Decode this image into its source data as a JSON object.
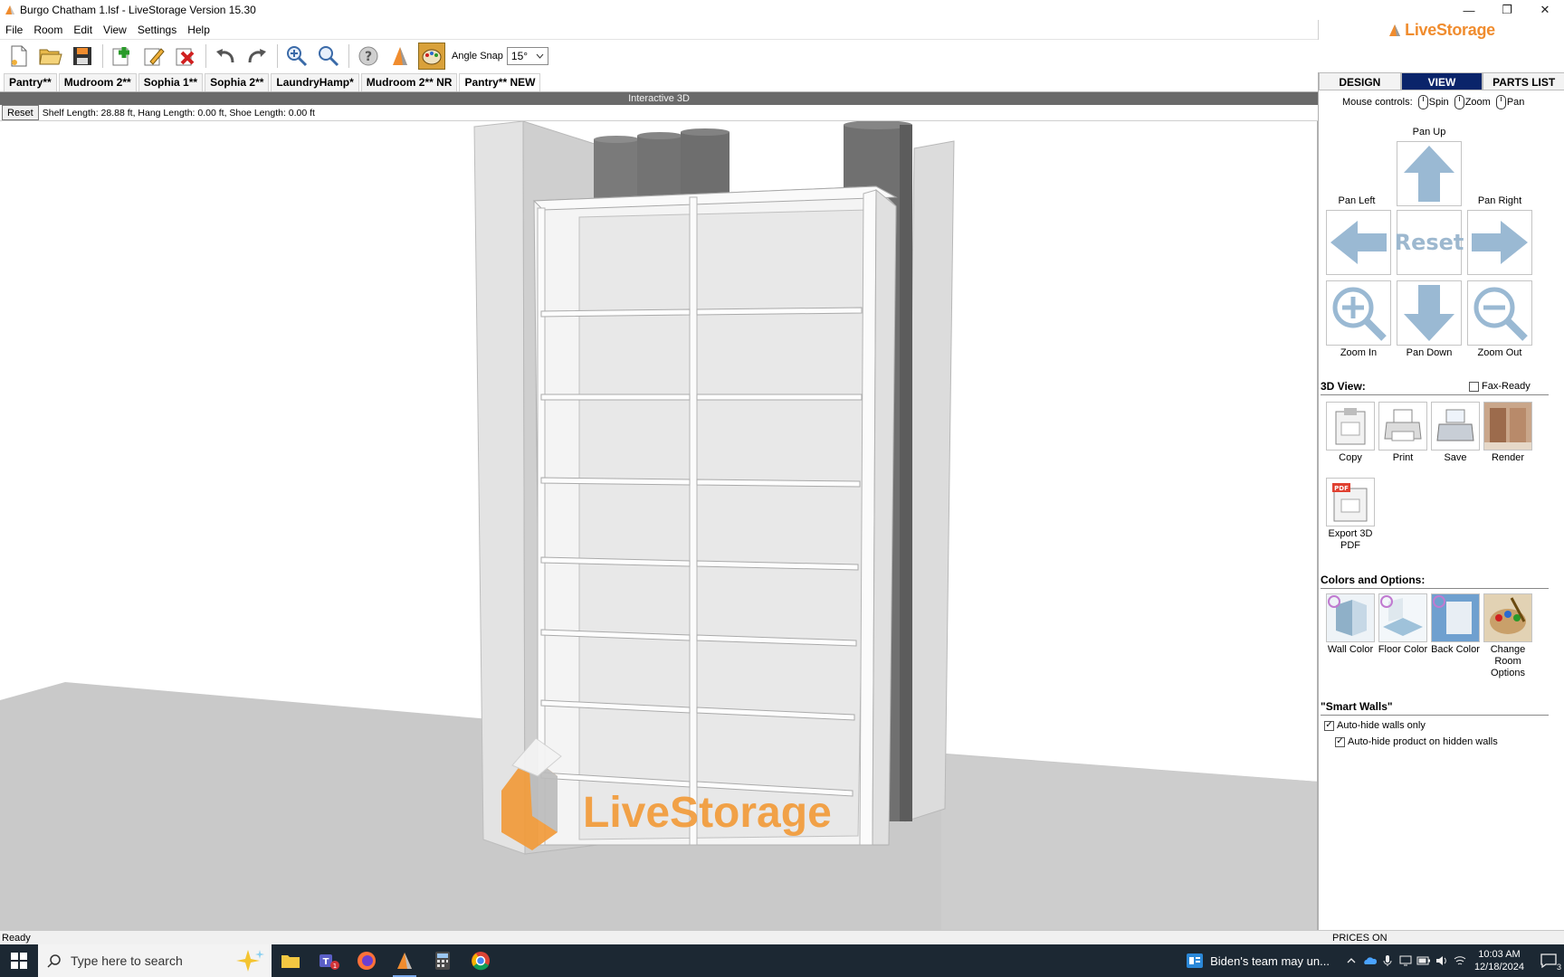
{
  "window": {
    "title": "Burgo Chatham 1.lsf - LiveStorage Version 15.30",
    "controls": [
      "—",
      "❐",
      "✕"
    ]
  },
  "menu": [
    "File",
    "Room",
    "Edit",
    "View",
    "Settings",
    "Help"
  ],
  "brand": {
    "name": "LiveStorage",
    "color": "#f08c2e"
  },
  "toolbar": {
    "angle_snap_label": "Angle Snap",
    "angle_snap_value": "15°"
  },
  "room_tabs": [
    {
      "label": "Pantry**"
    },
    {
      "label": "Mudroom 2**"
    },
    {
      "label": "Sophia 1**"
    },
    {
      "label": "Sophia 2**"
    },
    {
      "label": "LaundryHamp*"
    },
    {
      "label": "Mudroom 2** NR"
    },
    {
      "label": "Pantry** NEW",
      "active": true
    }
  ],
  "viewport": {
    "header": "Interactive 3D",
    "reset_label": "Reset",
    "info": "Shelf Length: 28.88 ft, Hang Length: 0.00 ft, Shoe Length: 0.00 ft",
    "watermark": "LiveStorage"
  },
  "panel": {
    "tabs": [
      {
        "label": "DESIGN"
      },
      {
        "label": "VIEW",
        "active": true
      },
      {
        "label": "PARTS LIST"
      }
    ],
    "mouse_controls": {
      "label": "Mouse controls:",
      "spin": "Spin",
      "zoom": "Zoom",
      "pan": "Pan"
    },
    "nav": {
      "pan_up": "Pan Up",
      "pan_left": "Pan Left",
      "pan_right": "Pan Right",
      "reset": "Reset",
      "zoom_in": "Zoom In",
      "pan_down": "Pan Down",
      "zoom_out": "Zoom Out"
    },
    "view3d": {
      "title": "3D View:",
      "fax_ready": "Fax-Ready",
      "copy": "Copy",
      "print": "Print",
      "save": "Save",
      "render": "Render",
      "export_pdf": "Export 3D PDF",
      "pdf_badge": "PDF"
    },
    "colors": {
      "title": "Colors and Options:",
      "wall": "Wall Color",
      "floor": "Floor Color",
      "back": "Back Color",
      "room": "Change Room Options"
    },
    "smart_walls": {
      "title": "\"Smart Walls\"",
      "auto_hide_walls": "Auto-hide walls only",
      "auto_hide_walls_checked": true,
      "auto_hide_product": "Auto-hide product on hidden walls",
      "auto_hide_product_checked": true
    }
  },
  "status": {
    "left": "Ready",
    "right": "PRICES ON"
  },
  "taskbar": {
    "search_placeholder": "Type here to search",
    "news": "Biden's team may un...",
    "time": "10:03 AM",
    "date": "12/18/2024",
    "notification_count": "3",
    "teams_badge": "1"
  }
}
